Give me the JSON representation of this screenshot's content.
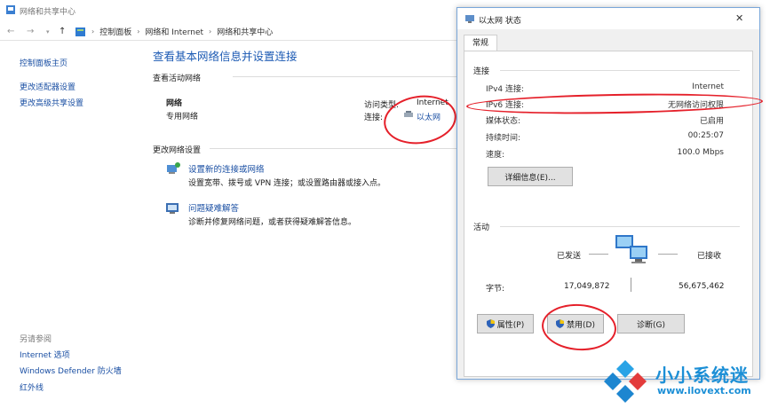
{
  "main_window": {
    "title": "网络和共享中心",
    "breadcrumb": [
      "控制面板",
      "网络和 Internet",
      "网络和共享中心"
    ],
    "sidebar": {
      "home": "控制面板主页",
      "links": [
        "更改适配器设置",
        "更改高级共享设置"
      ],
      "see_also_label": "另请参阅",
      "see_also": [
        "Internet 选项",
        "Windows Defender 防火墙",
        "红外线"
      ]
    },
    "heading": "查看基本网络信息并设置连接",
    "active_networks_label": "查看活动网络",
    "network": {
      "name": "网络",
      "type": "专用网络",
      "access_type_label": "访问类型:",
      "access_type_value": "Internet",
      "connection_label": "连接:",
      "connection_value": "以太网"
    },
    "change_settings_label": "更改网络设置",
    "tasks": [
      {
        "title": "设置新的连接或网络",
        "desc": "设置宽带、拨号或 VPN 连接；或设置路由器或接入点。"
      },
      {
        "title": "问题疑难解答",
        "desc": "诊断并修复网络问题，或者获得疑难解答信息。"
      }
    ]
  },
  "dialog": {
    "title": "以太网 状态",
    "close_glyph": "✕",
    "tab": "常规",
    "connection_section": "连接",
    "rows": [
      {
        "label": "IPv4 连接:",
        "value": "Internet"
      },
      {
        "label": "IPv6 连接:",
        "value": "无网络访问权限"
      },
      {
        "label": "媒体状态:",
        "value": "已启用"
      },
      {
        "label": "持续时间:",
        "value": "00:25:07"
      },
      {
        "label": "速度:",
        "value": "100.0 Mbps"
      }
    ],
    "details_button": "详细信息(E)...",
    "activity_section": "活动",
    "sent_label": "已发送",
    "received_label": "已接收",
    "bytes_label": "字节:",
    "bytes_sent": "17,049,872",
    "bytes_received": "56,675,462",
    "buttons": {
      "properties": "属性(P)",
      "disable": "禁用(D)",
      "diagnose": "诊断(G)"
    }
  },
  "watermark": {
    "brand": "小小系统迷",
    "url": "www.ilovext.com"
  },
  "colors": {
    "link": "#1a4fa3",
    "heading": "#1d5bb4",
    "annotation": "#e5202a",
    "watermark": "#1c8fd6"
  }
}
